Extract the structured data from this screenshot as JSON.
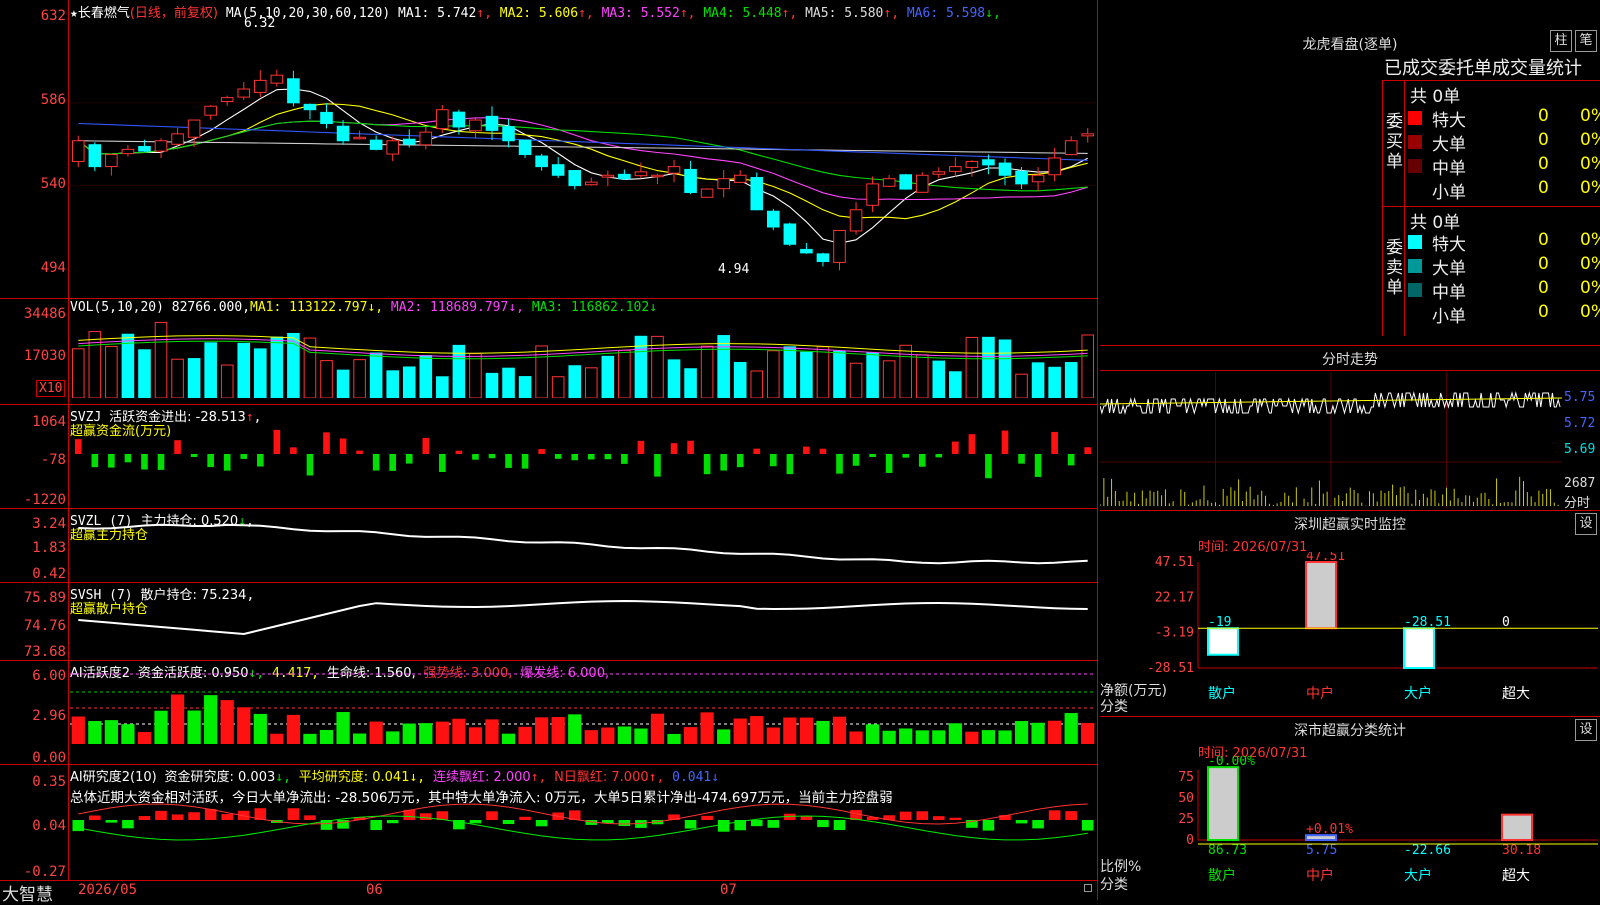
{
  "stock": {
    "name": "长春燃气",
    "mode": "(日线，前复权)",
    "star": "★"
  },
  "price": {
    "indicator": "MA(5,10,20,30,60,120)",
    "ma": [
      {
        "label": "MA1:",
        "value": "5.742",
        "arrow": "↑",
        "color": "#ffffff"
      },
      {
        "label": "MA2:",
        "value": "5.606",
        "arrow": "↑",
        "color": "#ffff00"
      },
      {
        "label": "MA3:",
        "value": "5.552",
        "arrow": "↑",
        "color": "#ff44ff"
      },
      {
        "label": "MA4:",
        "value": "5.448",
        "arrow": "↑",
        "color": "#00e000"
      },
      {
        "label": "MA5:",
        "value": "5.580",
        "arrow": "↑",
        "color": "#dddddd"
      },
      {
        "label": "MA6:",
        "value": "5.598",
        "arrow": "↓",
        "color": "#4466ff"
      }
    ],
    "yticks": [
      "632",
      "586",
      "540",
      "494"
    ],
    "high_label": "6.32",
    "low_label": "4.94"
  },
  "volume": {
    "indicator": "VOL(5,10,20)",
    "vol": "82766.000",
    "ma1": "MA1: 113122.797",
    "ma2": "MA2: 118689.797",
    "ma3": "MA3: 116862.102",
    "yticks": [
      "34486",
      "17030"
    ],
    "unit": "X10"
  },
  "svzj": {
    "indicator": "SVZJ",
    "text": "活跃资金进出: -28.513",
    "arrow": "↑",
    "sub": "超赢资金流(万元)",
    "yticks": [
      "1064",
      "-78",
      "-1220"
    ]
  },
  "svzl": {
    "indicator": "SVZL (7)",
    "text": "主力持仓: 0.520",
    "arrow": "↓",
    "sub": "超赢主力持仓",
    "yticks": [
      "3.24",
      "1.83",
      "0.42"
    ]
  },
  "svsh": {
    "indicator": "SVSH (7)",
    "text": "散户持仓: 75.234",
    "arrow": "↓",
    "sub": "超赢散户持仓",
    "yticks": [
      "75.89",
      "74.76",
      "73.68"
    ]
  },
  "ai1": {
    "indicator": "AI活跃度2",
    "t1": "资金活跃度: 0.950",
    "t2": "4.417,",
    "t3": "生命线: 1.560,",
    "t4": "强势线: 3.000,",
    "t5": "爆发线: 6.000,",
    "yticks": [
      "6.00",
      "2.96",
      "0.00"
    ]
  },
  "ai2": {
    "indicator": "AI研究度2(10)",
    "t1": "资金研究度: 0.003",
    "t2": "平均研究度: 0.041",
    "t3": "连续飘红: 2.000",
    "t4": "N日飘红: 7.000",
    "t5": "0.041",
    "summary": "总体近期大资金相对活跃，今日大单净流出: -28.506万元，其中特大单净流入: 0万元，大单5日累计净出-474.697万元，当前主力控盘弱",
    "yticks": [
      "0.35",
      "0.04",
      "-0.27"
    ]
  },
  "dates": {
    "d1": "2026/05",
    "d2": "06",
    "d3": "07"
  },
  "brand": "大智慧",
  "longhu": {
    "title": "龙虎看盘(逐单)",
    "btn1": "柱",
    "btn2": "笔",
    "subtitle": "已成交委托单成交量统计",
    "buy_label": "委买单",
    "sell_label": "委卖单",
    "buy_total": "共 0单",
    "sell_total": "共 0单",
    "buy_rows": [
      {
        "name": "特大",
        "v": "0",
        "p": "0%",
        "color": "#ff0000"
      },
      {
        "name": "大单",
        "v": "0",
        "p": "0%",
        "color": "#990000"
      },
      {
        "name": "中单",
        "v": "0",
        "p": "0%",
        "color": "#660000"
      },
      {
        "name": "小单",
        "v": "0",
        "p": "0%",
        "color": "#000000"
      }
    ],
    "sell_rows": [
      {
        "name": "特大",
        "v": "0",
        "p": "0%",
        "color": "#00ffff"
      },
      {
        "name": "大单",
        "v": "0",
        "p": "0%",
        "color": "#009999"
      },
      {
        "name": "中单",
        "v": "0",
        "p": "0%",
        "color": "#006666"
      },
      {
        "name": "小单",
        "v": "0",
        "p": "0%",
        "color": "#000000"
      }
    ]
  },
  "intraday": {
    "title": "分时走势",
    "yticks": [
      "5.75",
      "5.72",
      "5.69"
    ],
    "vol_label": "2687",
    "vol_unit": "分时"
  },
  "sz_monitor": {
    "title": "深圳超赢实时监控",
    "btn": "设",
    "time": "时间: 2026/07/31",
    "yticks": [
      "47.51",
      "22.17",
      "-3.19",
      "-28.51"
    ],
    "ylabel1": "净额(万元)",
    "ylabel2": "分类",
    "categories": [
      "散户",
      "中户",
      "大户",
      "超大"
    ],
    "values": [
      -19,
      47.51,
      -28.51,
      0
    ],
    "value_labels": [
      "-19",
      "47.51",
      "-28.51",
      "0"
    ]
  },
  "sz_class": {
    "title": "深市超赢分类统计",
    "btn": "设",
    "time": "时间: 2026/07/31",
    "yticks": [
      "75",
      "50",
      "25",
      "0"
    ],
    "ylabel1": "比例%",
    "ylabel2": "分类",
    "categories": [
      "散户",
      "中户",
      "大户",
      "超大"
    ],
    "top_labels": [
      "-0.00%",
      "+0.01%",
      "",
      ""
    ],
    "bottom_values": [
      "86.73",
      "5.75",
      "-22.66",
      "30.18"
    ],
    "bottom_colors": [
      "#00e000",
      "#4466ff",
      "#00ffff",
      "#ff3333"
    ],
    "cat_colors": [
      "#00e000",
      "#ff3333",
      "#00ffff",
      "#ffffff"
    ]
  },
  "colors": {
    "up": "#ff3333",
    "down": "#00ffff",
    "grid": "#cc0000",
    "axis_text": "#ff4444"
  }
}
